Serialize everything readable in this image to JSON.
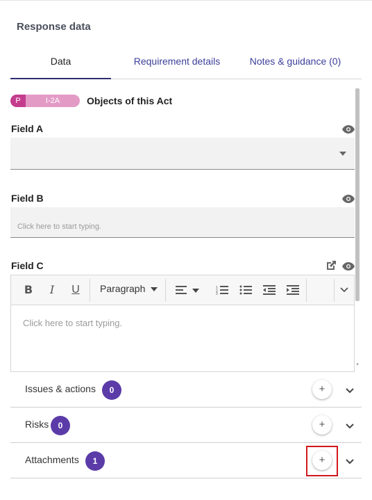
{
  "panel": {
    "title": "Response data"
  },
  "tabs": [
    {
      "label": "Data",
      "active": true
    },
    {
      "label": "Requirement details",
      "active": false
    },
    {
      "label": "Notes & guidance (0)",
      "active": false
    }
  ],
  "requirement": {
    "badge_letter": "P",
    "badge_id": "I-2A",
    "title": "Objects of this Act"
  },
  "fields": {
    "field_a": {
      "label": "Field A",
      "value": ""
    },
    "field_b": {
      "label": "Field B",
      "placeholder": "Click here to start typing."
    },
    "field_c": {
      "label": "Field C",
      "placeholder": "Click here to start typing.",
      "toolbar": {
        "paragraph_label": "Paragraph"
      }
    }
  },
  "sections": [
    {
      "label": "Issues & actions",
      "count": "0",
      "add": "+"
    },
    {
      "label": "Risks",
      "count": "0",
      "add": "+"
    },
    {
      "label": "Attachments",
      "count": "1",
      "add": "+"
    }
  ],
  "colors": {
    "accent": "#5b3ba8",
    "tag": "#c43d8d",
    "tag_light": "#e39bc6",
    "tab_link": "#3b3f9a",
    "highlight": "#d0181e"
  },
  "icons": [
    "eye-icon",
    "external-link-icon",
    "bold-icon",
    "italic-icon",
    "underline-icon",
    "align-left-icon",
    "ordered-list-icon",
    "bullet-list-icon",
    "outdent-icon",
    "indent-icon",
    "chevron-down-icon",
    "plus-icon"
  ]
}
